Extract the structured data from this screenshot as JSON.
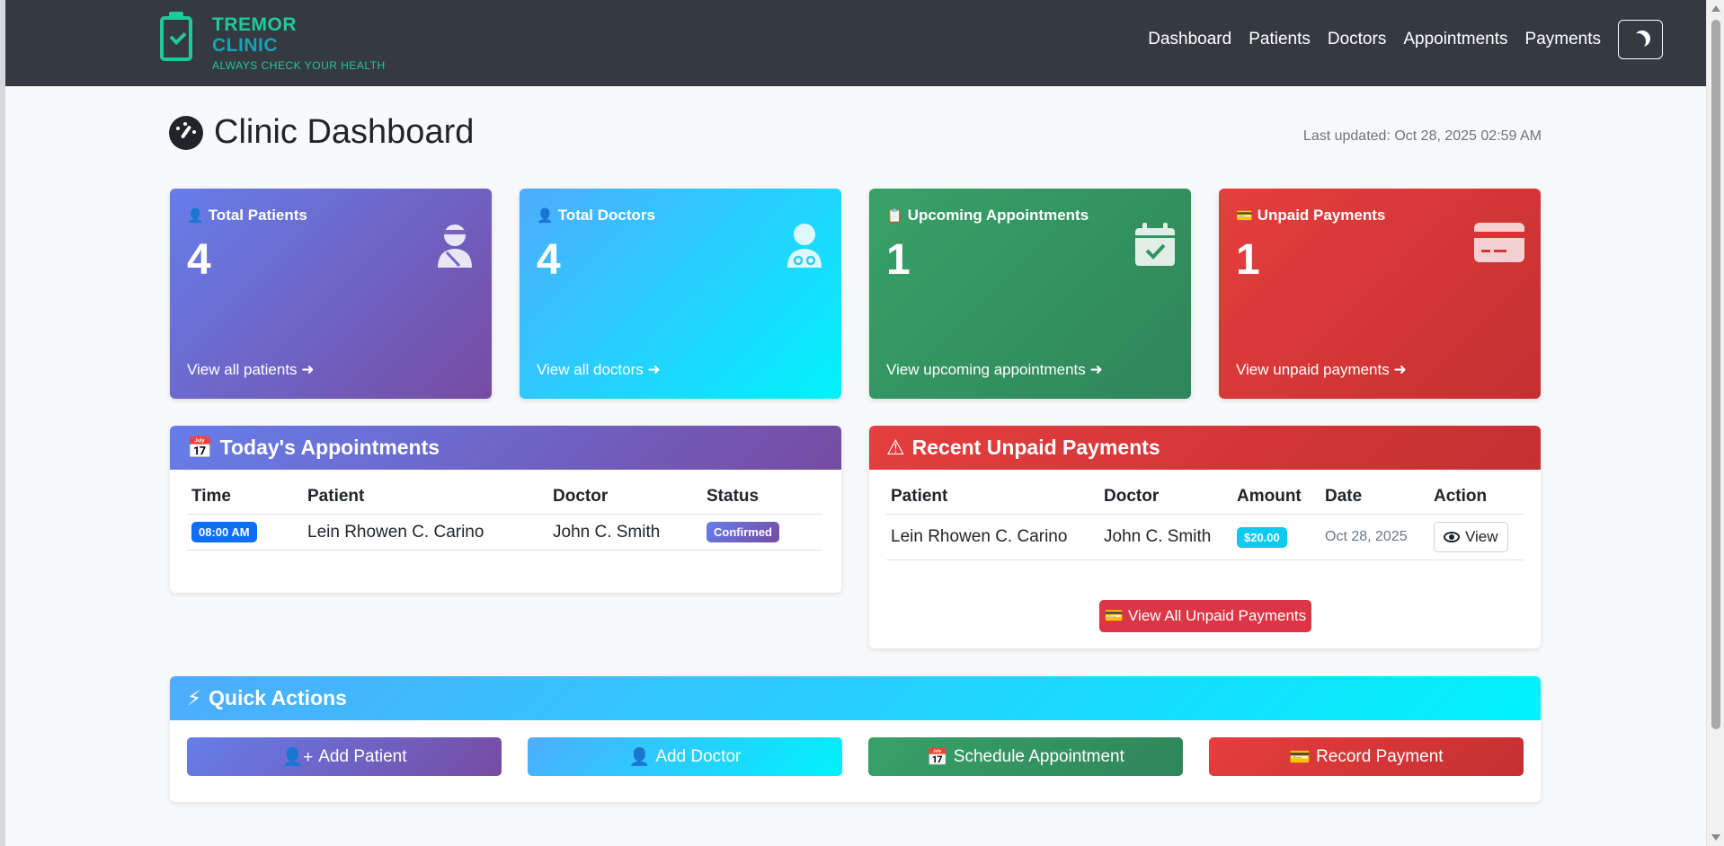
{
  "brand": {
    "title_line1": "TREMOR",
    "title_line2": "CLINIC",
    "tagline": "ALWAYS CHECK YOUR HEALTH"
  },
  "nav": {
    "items": [
      "Dashboard",
      "Patients",
      "Doctors",
      "Appointments",
      "Payments"
    ]
  },
  "header": {
    "title": "Clinic Dashboard",
    "last_updated": "Last updated: Oct 28, 2025 02:59 AM"
  },
  "stats": [
    {
      "title": "Total Patients",
      "value": "4",
      "link": "View all patients",
      "icon": "patient-icon",
      "color": "#764ba2"
    },
    {
      "title": "Total Doctors",
      "value": "4",
      "link": "View all doctors",
      "icon": "doctor-icon",
      "color": "#00f2fe"
    },
    {
      "title": "Upcoming Appointments",
      "value": "1",
      "link": "View upcoming appointments",
      "icon": "calendar-check-icon",
      "color": "#38a169"
    },
    {
      "title": "Unpaid Payments",
      "value": "1",
      "link": "View unpaid payments",
      "icon": "credit-card-icon",
      "color": "#e53e3e"
    }
  ],
  "appointments": {
    "title": "Today's Appointments",
    "columns": [
      "Time",
      "Patient",
      "Doctor",
      "Status"
    ],
    "rows": [
      {
        "time": "08:00 AM",
        "patient": "Lein Rhowen C. Carino",
        "doctor": "John C. Smith",
        "status": "Confirmed"
      }
    ]
  },
  "payments": {
    "title": "Recent Unpaid Payments",
    "columns": [
      "Patient",
      "Doctor",
      "Amount",
      "Date",
      "Action"
    ],
    "rows": [
      {
        "patient": "Lein Rhowen C. Carino",
        "doctor": "John C. Smith",
        "amount": "$20.00",
        "date": "Oct 28, 2025",
        "action": "View"
      }
    ],
    "view_all": "View All Unpaid Payments"
  },
  "quick_actions": {
    "title": "Quick Actions",
    "buttons": [
      "Add Patient",
      "Add Doctor",
      "Schedule Appointment",
      "Record Payment"
    ]
  }
}
